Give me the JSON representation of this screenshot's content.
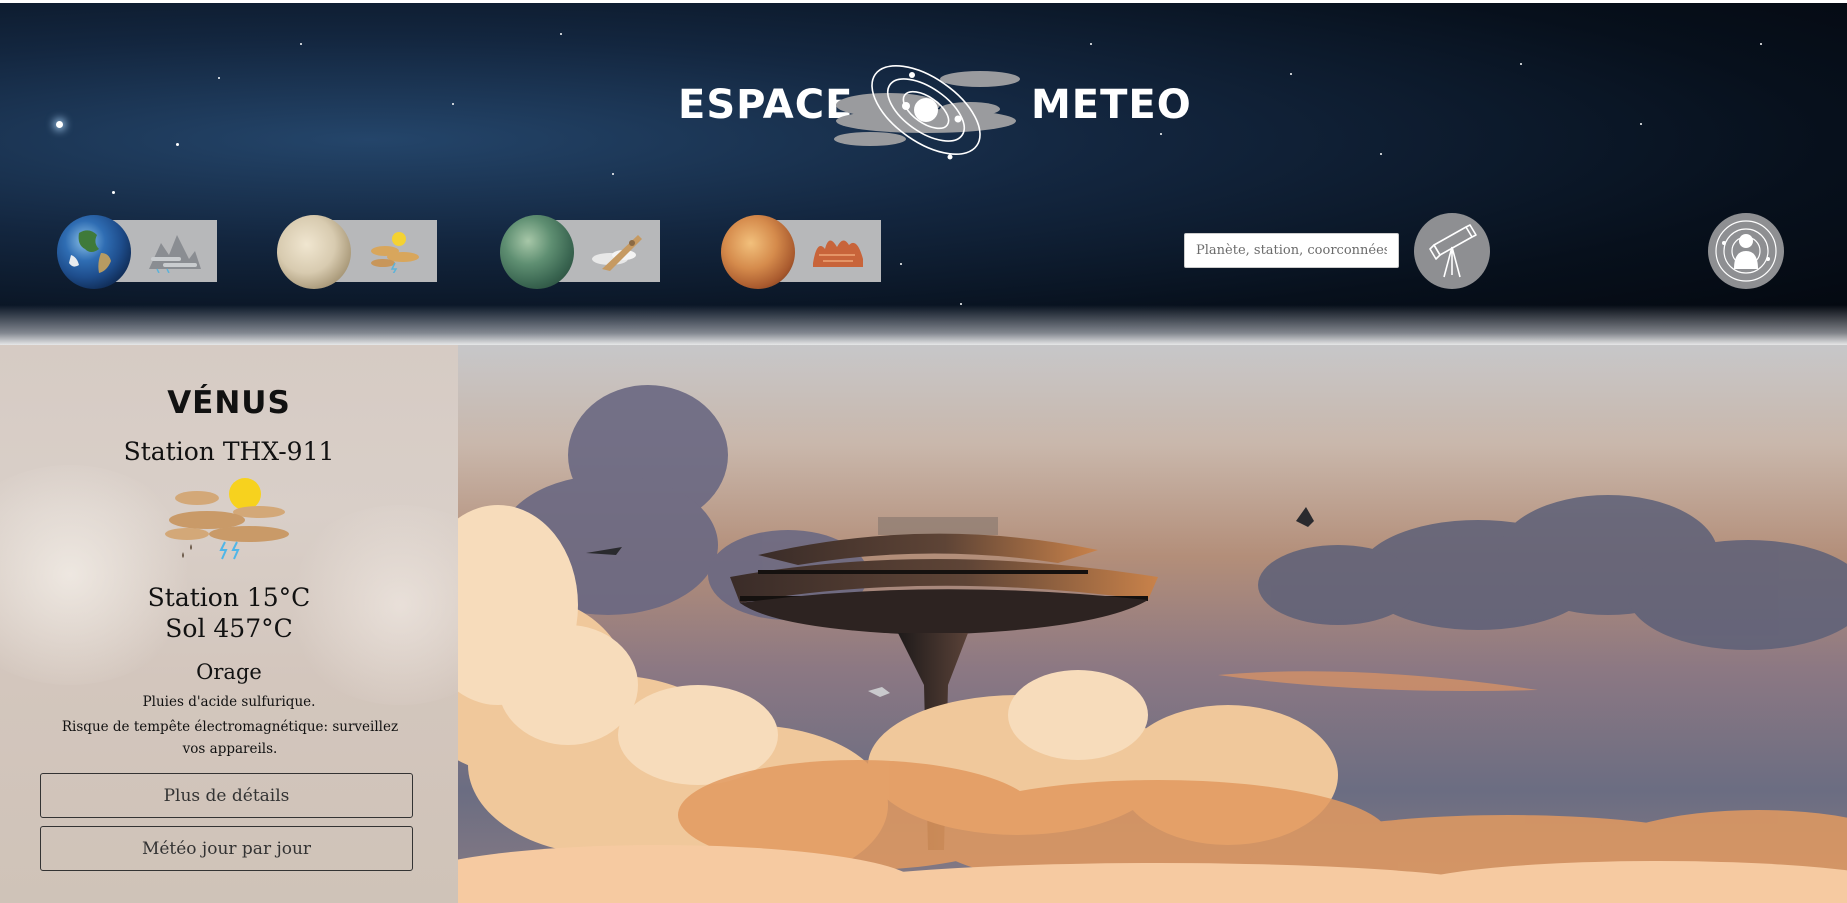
{
  "header": {
    "brand_left": "ESPACE",
    "brand_right": "METEO",
    "planet_tabs": [
      {
        "planet": "earth",
        "planet_icon": "earth-planet-icon",
        "weather_icon": "mountain-fog-icon",
        "color": "#3a78c2"
      },
      {
        "planet": "venus",
        "planet_icon": "venus-planet-icon",
        "weather_icon": "sun-cloud-storm-icon",
        "color": "#cfc3aa"
      },
      {
        "planet": "titan",
        "planet_icon": "titan-planet-icon",
        "weather_icon": "cloud-spaceship-icon",
        "color": "#4f7d65"
      },
      {
        "planet": "mars",
        "planet_icon": "mars-planet-icon",
        "weather_icon": "dust-storm-icon",
        "color": "#c2693b"
      }
    ],
    "search": {
      "placeholder": "Planète, station, coorconnées"
    },
    "telescope_icon": "telescope-icon",
    "profile_icon": "astronaut-profile-icon"
  },
  "sidebar": {
    "planet_name": "VÉNUS",
    "station_name": "Station THX-911",
    "weather_icon": "sun-cloud-acid-rain-lightning-icon",
    "temp_station": "Station 15°C",
    "temp_ground": "Sol 457°C",
    "condition": "Orage",
    "description_line1": "Pluies d'acide sulfurique.",
    "description_line2": "Risque de tempête électromagnétique: surveillez vos appareils.",
    "buttons": {
      "details": "Plus de détails",
      "daily": "Météo jour par jour"
    }
  },
  "hero": {
    "scene": "floating-cloud-city",
    "colors": {
      "cloud_light": "#f2d2b0",
      "cloud_warm": "#e7a26a",
      "sky_dusk": "#6b6d82",
      "city_hull": "#4a3a33"
    }
  }
}
